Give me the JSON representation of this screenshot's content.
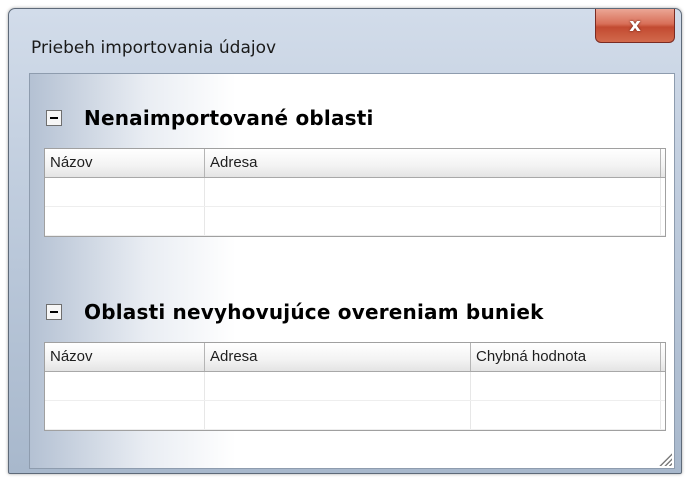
{
  "window": {
    "title": "Priebeh importovania údajov",
    "close_label": "x"
  },
  "sections": [
    {
      "title": "Nenaimportované oblasti",
      "toggle_symbol": "-",
      "columns": [
        "Názov",
        "Adresa"
      ],
      "rows": [
        [
          "",
          ""
        ],
        [
          "",
          ""
        ]
      ]
    },
    {
      "title": "Oblasti nevyhovujúce overeniam buniek",
      "toggle_symbol": "-",
      "columns": [
        "Názov",
        "Adresa",
        "Chybná hodnota"
      ],
      "rows": [
        [
          "",
          "",
          ""
        ],
        [
          "",
          "",
          ""
        ]
      ]
    }
  ],
  "colors": {
    "close_button": "#c24a31",
    "frame": "#b9c7d9"
  }
}
